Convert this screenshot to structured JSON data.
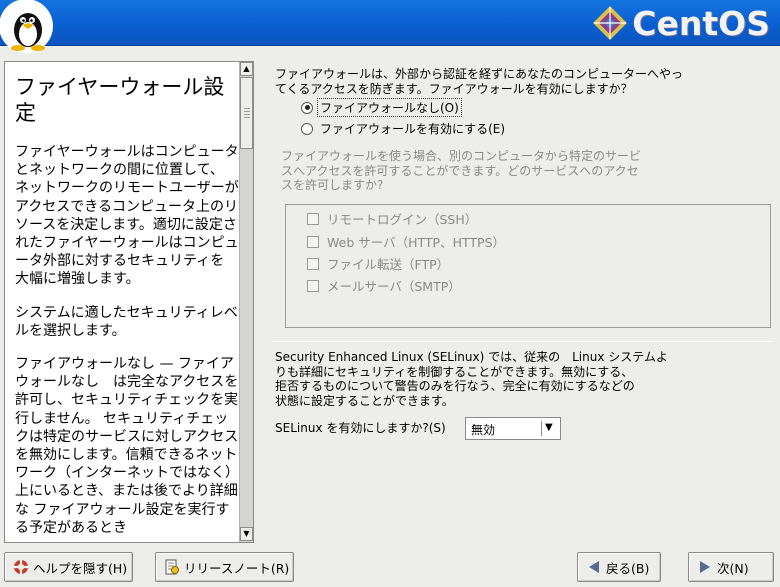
{
  "header": {
    "brand": "CentOS"
  },
  "help": {
    "title": "ファイヤーウォール設定",
    "paragraphs": [
      "ファイヤーウォールはコンピュータとネットワークの間に位置して、 ネットワークのリモートユーザーがアクセスできるコンピュータ上のリソースを決定します。適切に設定されたファイヤーウォールはコンピュータ外部に対するセキュリティを 大幅に増強します。",
      "システムに適したセキュリティレベルを選択します。",
      "ファイアウォールなし — ファイアウォールなし　は完全なアクセスを許可し、セキュリティチェックを実行しません。 セキュリティチェックは特定のサービスに対しアクセスを無効にします。信頼できるネットワーク（インターネットではなく）上にいるとき、または後でより詳細な ファイアウォール設定を実行する予定があるとき"
    ]
  },
  "firewall": {
    "intro_line1": "ファイアウォールは、外部から認証を経ずにあなたのコンピューターへやっ",
    "intro_line2": "てくるアクセスを防ぎます。ファイアウォールを有効にしますか？",
    "option_none": "ファイアウォールなし(O)",
    "option_enable": "ファイアウォールを有効にする(E)",
    "services_desc_line1": "ファイアウォールを使う場合、別のコンピュータから特定のサービ",
    "services_desc_line2": "スへアクセスを許可することができます。どのサービスへのアクセ",
    "services_desc_line3": "スを許可しますか?",
    "services": [
      {
        "label": "リモートログイン（SSH）",
        "checked": false
      },
      {
        "label": "Web サーバ（HTTP、HTTPS）",
        "checked": false
      },
      {
        "label": "ファイル転送（FTP）",
        "checked": false
      },
      {
        "label": "メールサーバ（SMTP）",
        "checked": false
      }
    ]
  },
  "selinux": {
    "desc_line1": "Security Enhanced Linux (SELinux) では、従来の　Linux システムよ",
    "desc_line2": "りも詳細にセキュリティを制御することができます。無効にする、",
    "desc_line3": "拒否するものについて警告のみを行なう、完全に有効にするなどの",
    "desc_line4": "状態に設定することができます。",
    "prompt": "SELinux を有効にしますか?(S)",
    "selected": "無効"
  },
  "buttons": {
    "hide_help": "ヘルプを隠す(H)",
    "release_notes": "リリースノート(R)",
    "back": "戻る(B)",
    "next": "次(N)"
  }
}
